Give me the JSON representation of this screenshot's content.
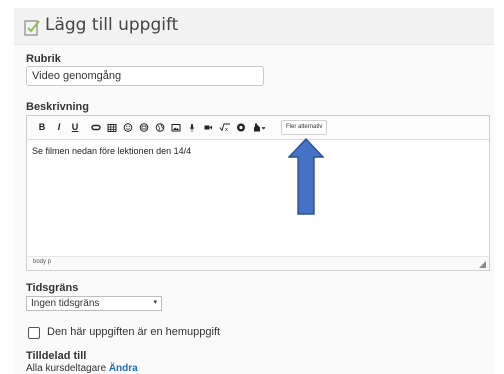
{
  "page": {
    "title": "Lägg till uppgift",
    "title_icon": "edit-document-icon"
  },
  "form": {
    "heading_label": "Rubrik",
    "heading_value": "Video genomgång",
    "description_label": "Beskrivning",
    "editor": {
      "toolbar": {
        "bold_label": "B",
        "italic_label": "I",
        "underline_label": "U",
        "more_label": "Fler alternativ",
        "icons": [
          "link-icon",
          "table-icon",
          "emoji-icon",
          "insert-icon",
          "globe-icon",
          "image-icon",
          "microphone-icon",
          "video-icon",
          "math-icon",
          "media-icon",
          "paint-dropdown-icon"
        ]
      },
      "body_text": "Se filmen nedan före lektionen den 14/4",
      "status_path": "body  p"
    },
    "deadline_label": "Tidsgräns",
    "deadline_value": "Ingen tidsgräns",
    "homework_label": "Den här uppgiften är en hemuppgift",
    "homework_checked": false,
    "assigned_label": "Tilldelad till",
    "assigned_value": "Alla kursdeltagare",
    "assigned_change_link": "Ändra"
  },
  "annotation": {
    "arrow_color": "#4472c4",
    "arrow_outline": "#2f4f8f"
  }
}
